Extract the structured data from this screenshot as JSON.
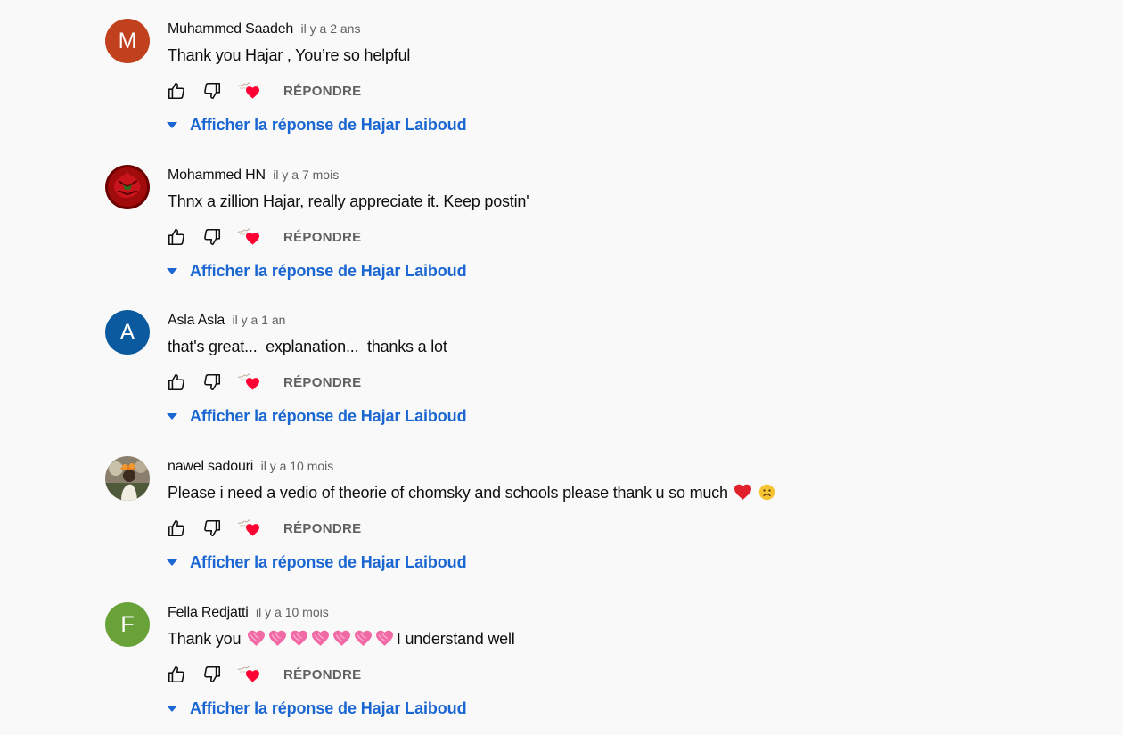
{
  "labels": {
    "reply": "RÉPONDRE",
    "show_reply": "Afficher la réponse de Hajar Laiboud"
  },
  "colors": {
    "link_blue": "#1a66d2",
    "meta_gray": "#606060",
    "heart_red": "#ff0033"
  },
  "comments": [
    {
      "author": "Muhammed Saadeh",
      "time": "il y a 2 ans",
      "text": "Thank you Hajar , You’re so helpful",
      "avatar_letter": "M",
      "avatar_color": "#c1401d"
    },
    {
      "author": "Mohammed HN",
      "time": "il y a 7 mois",
      "text": "Thnx a zillion Hajar, really appreciate it. Keep postin'",
      "avatar_letter": "",
      "avatar_icon": "red-flower-photo"
    },
    {
      "author": "Asla Asla",
      "time": "il y a 1 an",
      "text": "that's great...  explanation...  thanks a lot",
      "avatar_letter": "A",
      "avatar_color": "#0b5a9f"
    },
    {
      "author": "nawel sadouri",
      "time": "il y a 10 mois",
      "text": "Please i need a vedio of theorie of chomsky and schools please thank u so much",
      "emojis": [
        "red-heart-icon",
        "frowning-face-icon"
      ],
      "avatar_letter": "",
      "avatar_icon": "person-photo"
    },
    {
      "author": "Fella Redjatti",
      "time": "il y a 10 mois",
      "text_before": "Thank you",
      "text_after": "I understand well",
      "emoji_count": 7,
      "emoji_icon": "pink-heart-icon",
      "avatar_letter": "F",
      "avatar_color": "#6aa23a"
    }
  ]
}
